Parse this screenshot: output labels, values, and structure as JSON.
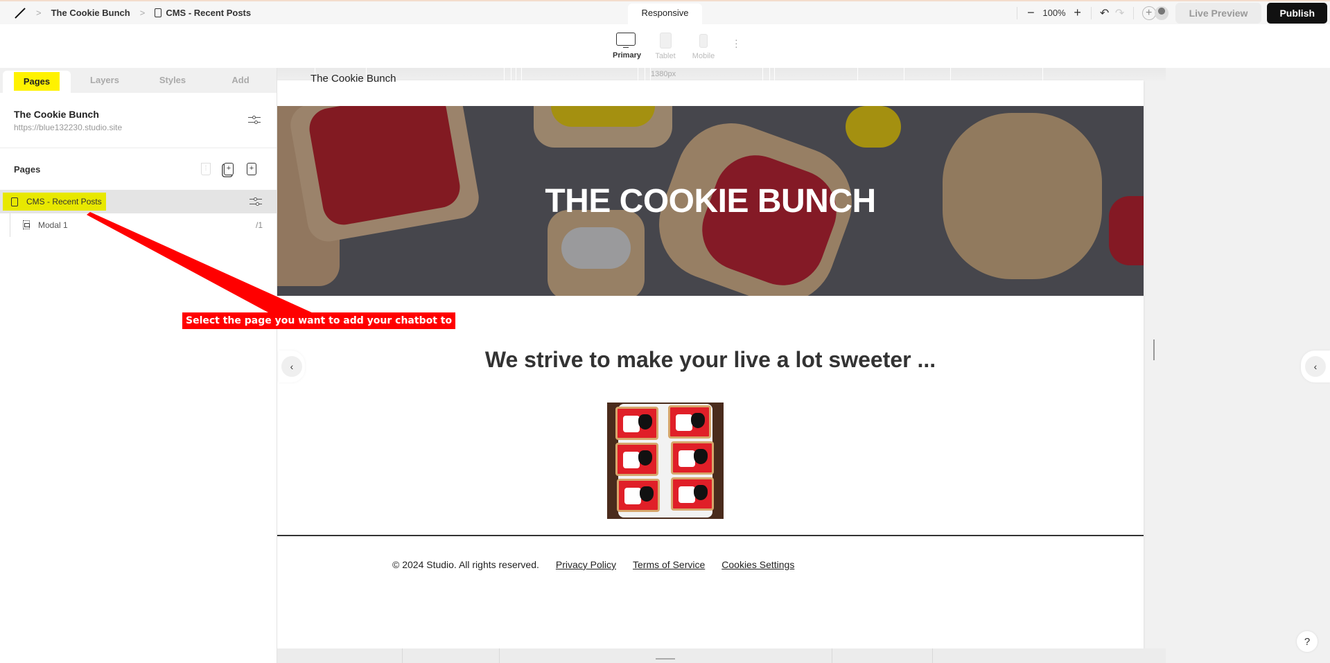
{
  "topbar": {
    "breadcrumb": [
      "The Cookie Bunch",
      "CMS - Recent Posts"
    ],
    "mode_tab": "Responsive",
    "zoom_level": "100%",
    "live_preview_label": "Live Preview",
    "publish_label": "Publish"
  },
  "devices": {
    "items": [
      {
        "label": "Primary",
        "active": true
      },
      {
        "label": "Tablet",
        "active": false
      },
      {
        "label": "Mobile",
        "active": false
      }
    ],
    "canvas_width_label": "1380px"
  },
  "leftpanel": {
    "tabs": [
      "Pages",
      "Layers",
      "Styles",
      "Add"
    ],
    "active_tab": "Pages",
    "site": {
      "name": "The Cookie Bunch",
      "url": "https://blue132230.studio.site"
    },
    "pages_title": "Pages",
    "pages": [
      {
        "label": "CMS - Recent Posts",
        "selected": true,
        "type": "page"
      },
      {
        "label": "Modal 1",
        "selected": false,
        "type": "modal",
        "path": "/1"
      }
    ]
  },
  "site_preview": {
    "header_title": "The Cookie Bunch",
    "hero_title": "THE COOKIE BUNCH",
    "tagline": "We strive to make your live a lot sweeter ...",
    "footer": {
      "copyright": "© 2024 Studio. All rights reserved.",
      "links": [
        "Privacy Policy",
        "Terms of Service",
        "Cookies Settings"
      ]
    }
  },
  "annotation": {
    "text": "Select the page you want to add your chatbot to",
    "color": "#ff0000"
  },
  "help_label": "?",
  "colors": {
    "highlight": "#fff200",
    "publish_bg": "#111111",
    "annotation_red": "#ff0000"
  }
}
